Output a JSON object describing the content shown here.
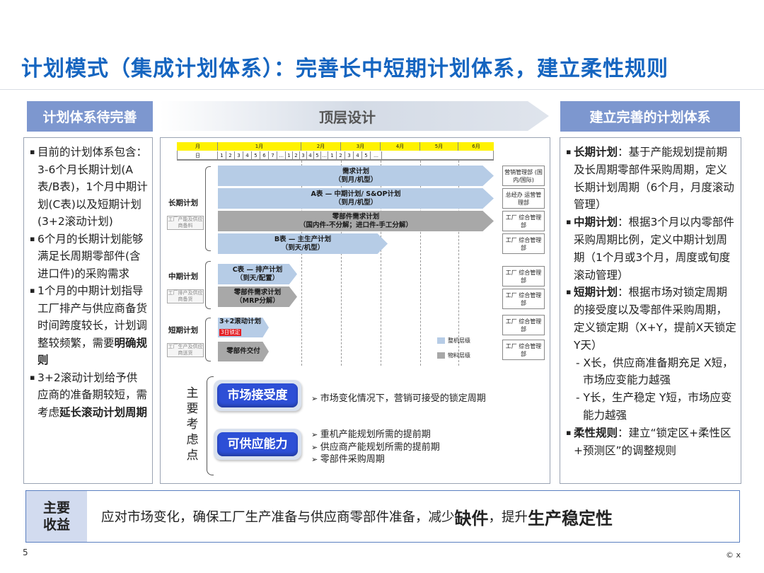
{
  "title": "计划模式（集成计划体系）：完善长中短期计划体系，建立柔性规则",
  "headers": {
    "left": "计划体系待完善",
    "middle": "顶层设计",
    "right": "建立完善的计划体系"
  },
  "left_bullets": [
    {
      "text": "目前的计划体系包含：3-6个月长期计划(A表/B表)，1个月中期计划(C表)以及短期计划(3+2滚动计划)",
      "bold": ""
    },
    {
      "text": "6个月的长期计划能够满足长周期零部件(含进口件)的采购需求",
      "bold": ""
    },
    {
      "text": "1个月的中期计划指导工厂排产与供应商备货时间跨度较长，计划调整较频繁，需要",
      "bold": "明确规则"
    },
    {
      "text": "3+2滚动计划给予供应商的准备期较短，需考虑",
      "bold": "延长滚动计划周期"
    }
  ],
  "right_bullets": [
    {
      "bold": "长期计划",
      "text": "：基于产能规划提前期及长周期零部件采购周期，定义长期计划周期（6个月，月度滚动管理）"
    },
    {
      "bold": "中期计划",
      "text": "：根据3个月以内零部件采购周期比例，定义中期计划周期（1个月或3个月，周度或旬度滚动管理）"
    },
    {
      "bold": "短期计划",
      "text": "：根据市场对锁定周期的接受度以及零部件采购周期，定义锁定期（X+Y，提前X天锁定Y天）"
    }
  ],
  "right_sub": [
    "- X长，供应商准备期充足 X短，市场应变能力越强",
    "- Y长，生产稳定 Y短，市场应变能力越强"
  ],
  "right_last": {
    "bold": "柔性规则",
    "text": "：建立“锁定区+柔性区+预测区”的调整规则"
  },
  "gantt": {
    "month_label": "月",
    "day_label": "日",
    "months": [
      "1月",
      "2月",
      "3月",
      "4月",
      "5月",
      "6月"
    ],
    "days_jan": [
      "1",
      "2",
      "3",
      "4",
      "5",
      "6",
      "7",
      "…",
      "1",
      "2",
      "3",
      "4",
      "5",
      "…",
      "1",
      "2",
      "3",
      "4",
      "5",
      "…"
    ],
    "groups": {
      "long": "长期计划",
      "mid": "中期计划",
      "short": "短期计划"
    },
    "mini_long": "工厂产能及供应商备料",
    "mini_mid": "工厂排产及供应商备货",
    "mini_short": "工厂生产及供应商送货",
    "bars": {
      "b1": [
        "需求计划",
        "（到月/机型）"
      ],
      "b2": [
        "A表 — 中期计划/ S&OP计划",
        "（到月/机型）"
      ],
      "b3": [
        "零部件需求计划",
        "（国内件-不分解；进口件-手工分解）"
      ],
      "b4": [
        "B表 — 主生产计划",
        "（到天/机型）"
      ],
      "b5": [
        "C表 — 排产计划",
        "（到天/配置）"
      ],
      "b6": [
        "零部件需求计划",
        "（MRP分解）"
      ],
      "b7": [
        "3+2滚动计划"
      ],
      "b8": [
        "零部件交付"
      ]
    },
    "lock_badge": "3日锁定",
    "depts": [
      "营销管理部 (国内/国际)",
      "总经办 运营管理部",
      "工厂 综合管理部",
      "工厂 综合管理部",
      "工厂 综合管理部",
      "工厂 综合管理部",
      "工厂 综合管理部",
      "工厂 综合管理部"
    ],
    "legend": {
      "machine": "整机层级",
      "material": "物料层级"
    },
    "colors": {
      "blue": "#b6cce6",
      "gray": "#a8a8a8",
      "yellow": "#fff200"
    }
  },
  "considerations": {
    "label": "主要考虑点",
    "market": {
      "pill": "市场接受度",
      "items": [
        "市场变化情况下，营销可接受的锁定周期"
      ]
    },
    "supply": {
      "pill": "可供应能力",
      "items": [
        "重机产能规划所需的提前期",
        "供应商产能规划所需的提前期",
        "零部件采购周期"
      ]
    }
  },
  "footer": {
    "label_1": "主要",
    "label_2": "收益",
    "text_1": "应对市场变化，确保工厂生产准备与供应商零部件准备，减少",
    "bold_1": "缺件",
    "text_2": "，提升",
    "bold_2": "生产稳定性"
  },
  "page_number": "5",
  "copyright": "© x"
}
